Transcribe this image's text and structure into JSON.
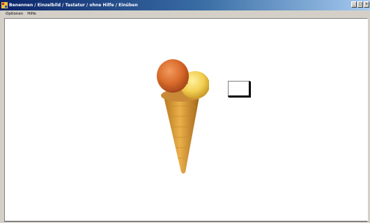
{
  "window": {
    "title": "Benennen / Einzelbild / Tastatur / ohne Hilfe / Einüben",
    "controls": [
      "minimize",
      "maximize",
      "close"
    ]
  },
  "menu": {
    "items": [
      "Optionen",
      "Hilfe"
    ]
  },
  "content": {
    "picture": "ice-cream-cone",
    "answer_value": ""
  },
  "colors": {
    "titlebar_start": "#0a246a",
    "titlebar_end": "#a6caf0",
    "client_background": "#ffffff"
  }
}
